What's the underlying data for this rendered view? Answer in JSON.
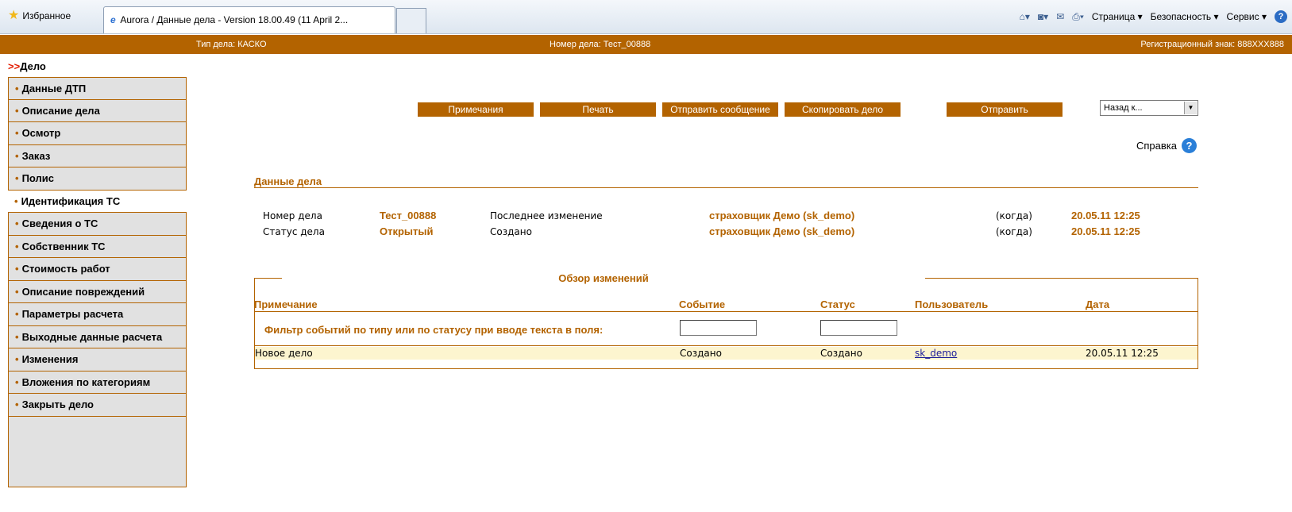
{
  "browser": {
    "favorites_label": "Избранное",
    "tab_title": "Aurora / Данные дела - Version 18.00.49 (11 April 2...",
    "tools": {
      "page": "Страница ▾",
      "safety": "Безопасность ▾",
      "service": "Сервис ▾"
    }
  },
  "infobar": {
    "case_type": "Тип дела: КАСКО",
    "case_number": "Номер дела: Тест_00888",
    "reg_sign": "Регистрационный знак: 888XXX888"
  },
  "sidebar": {
    "title_prefix": ">>",
    "title": "Дело",
    "items": [
      {
        "label": "Данные ДТП",
        "active": false
      },
      {
        "label": "Описание дела",
        "active": false
      },
      {
        "label": "Осмотр",
        "active": false
      },
      {
        "label": "Заказ",
        "active": false
      },
      {
        "label": "Полис",
        "active": false
      },
      {
        "label": "Идентификация ТС",
        "active": true
      },
      {
        "label": "Сведения о ТС",
        "active": false
      },
      {
        "label": "Собственник ТС",
        "active": false
      },
      {
        "label": "Стоимость работ",
        "active": false
      },
      {
        "label": "Описание повреждений",
        "active": false
      },
      {
        "label": "Параметры расчета",
        "active": false
      },
      {
        "label": "Выходные данные расчета",
        "active": false
      },
      {
        "label": "Изменения",
        "active": false
      },
      {
        "label": "Вложения по категориям",
        "active": false
      },
      {
        "label": "Закрыть дело",
        "active": false
      }
    ]
  },
  "toolbar": {
    "notes": "Примечания",
    "print": "Печать",
    "send_message": "Отправить сообщение",
    "copy_case": "Скопировать дело",
    "send": "Отправить",
    "back_select": "Назад к...",
    "help": "Справка"
  },
  "case_data": {
    "section_title": "Данные дела",
    "number_label": "Номер дела",
    "number_value": "Тест_00888",
    "status_label": "Статус дела",
    "status_value": "Открытый",
    "last_change_label": "Последнее изменение",
    "last_change_user": "страховщик Демо (sk_demo)",
    "last_change_when": "(когда)",
    "last_change_date": "20.05.11 12:25",
    "created_label": "Создано",
    "created_user": "страховщик Демо (sk_demo)",
    "created_when": "(когда)",
    "created_date": "20.05.11 12:25"
  },
  "overview": {
    "title": "Обзор изменений",
    "columns": {
      "note": "Примечание",
      "event": "Событие",
      "status": "Статус",
      "user": "Пользователь",
      "date": "Дата"
    },
    "filter_label": "Фильтр событий по типу или по статусу при вводе текста в поля:",
    "rows": [
      {
        "note": "Новое дело",
        "event": "Создано",
        "status": "Создано",
        "user": "sk_demo",
        "date": "20.05.11 12:25"
      }
    ]
  },
  "colors": {
    "accent": "#b36300",
    "sidebar_bg": "#e1e1e1",
    "row_highlight": "#fdf5cf"
  }
}
